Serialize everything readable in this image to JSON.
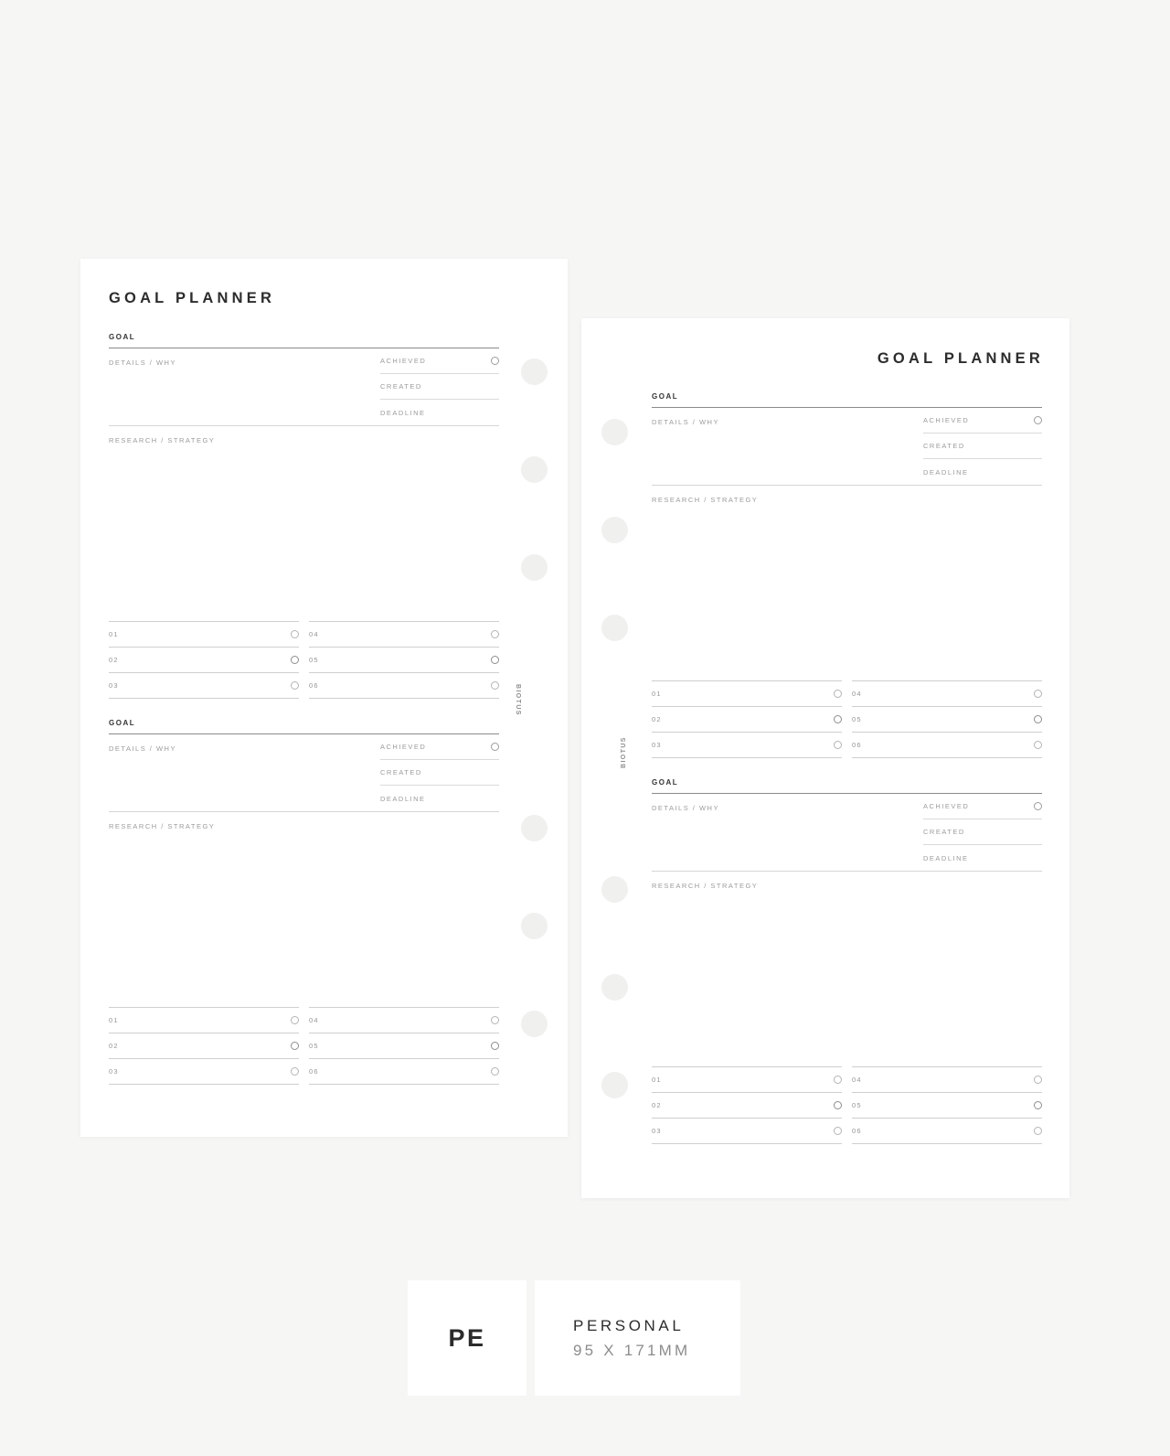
{
  "document": {
    "title": "GOAL PLANNER",
    "brand": "BIOTUS"
  },
  "labels": {
    "goal": "GOAL",
    "details_why": "DETAILS / WHY",
    "research_strategy": "RESEARCH / STRATEGY",
    "achieved": "ACHIEVED",
    "created": "CREATED",
    "deadline": "DEADLINE"
  },
  "task_numbers": {
    "left_col": [
      "01",
      "02",
      "03"
    ],
    "right_col": [
      "04",
      "05",
      "06"
    ]
  },
  "footer": {
    "badge": "PE",
    "name": "PERSONAL",
    "size": "95 X 171MM"
  },
  "colors": {
    "background": "#f6f6f5",
    "page": "#ffffff",
    "title_text": "#2c2c2c",
    "muted_text": "#9b9b9b",
    "rule_strong": "#8a8a8a",
    "rule_light": "#cfcfcf",
    "hole": "#f0f0ef"
  }
}
